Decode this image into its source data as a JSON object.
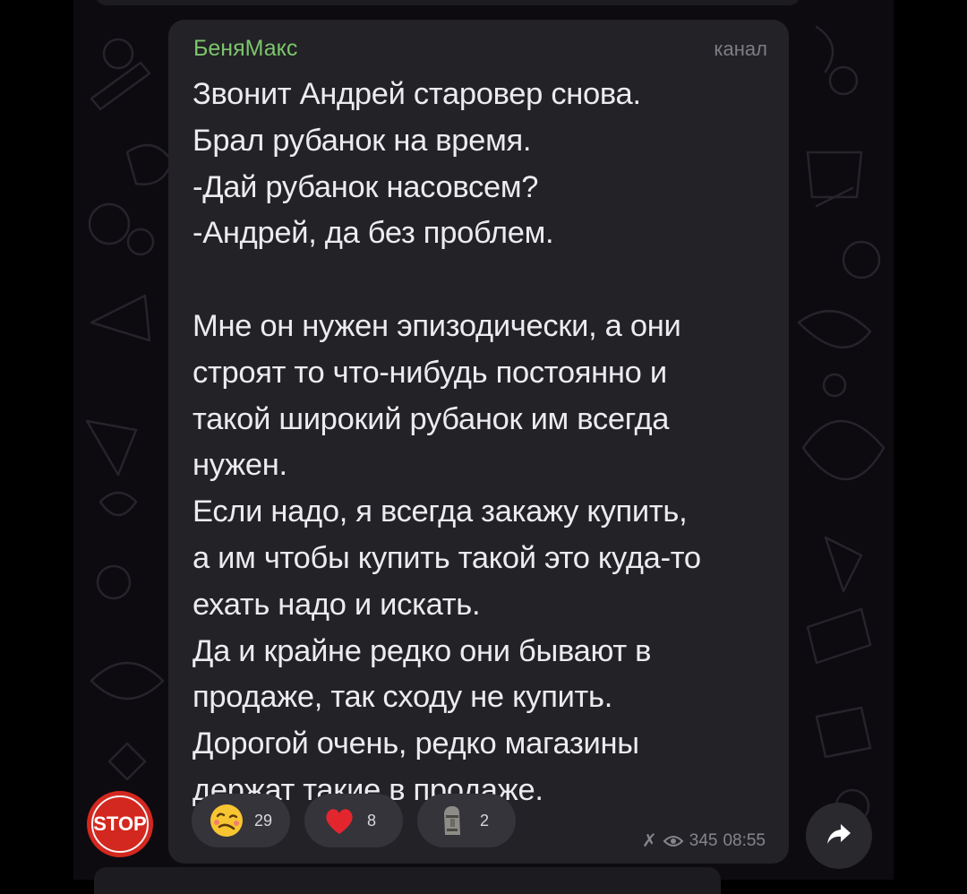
{
  "message": {
    "sender": "БеняМакс",
    "badge": "канал",
    "lines": [
      "Звонит Андрей старовер снова.",
      "Брал рубанок на время.",
      "-Дай рубанок насовсем?",
      "-Андрей, да без проблем.",
      "",
      "Мне он нужен эпизодически, а они",
      "строят то что-нибудь постоянно и",
      "такой широкий рубанок им всегда",
      "нужен.",
      "Если надо, я всегда закажу купить,",
      "а им чтобы купить такой это куда-то",
      "ехать надо и искать.",
      "Да и крайне редко они бывают в",
      "продаже, так сходу не купить.",
      "Дорогой очень, редко магазины",
      "держат такие в продаже."
    ],
    "reactions": [
      {
        "emoji": "woozy-face-icon",
        "count": "29"
      },
      {
        "emoji": "heart-icon",
        "count": "8"
      },
      {
        "emoji": "moai-icon",
        "count": "2"
      }
    ],
    "views": "345",
    "time": "08:55"
  },
  "avatar": {
    "label": "STOP"
  },
  "colors": {
    "sender": "#7cc56c",
    "bubble": "#232227",
    "background": "#0d0b10",
    "avatar": "#d3281f"
  }
}
